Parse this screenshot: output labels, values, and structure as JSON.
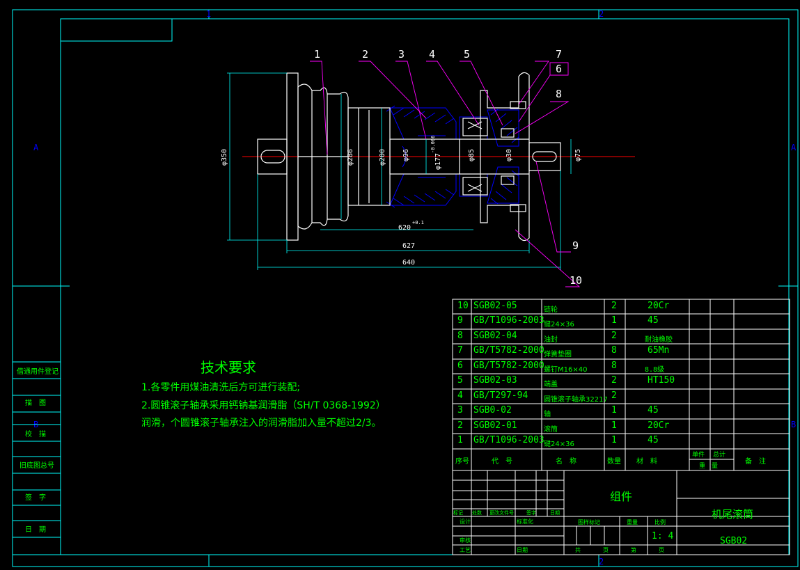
{
  "zone_marks": {
    "top_1": "1",
    "top_2": "2",
    "bottom_2": "2",
    "left_a": "A",
    "right_a": "A",
    "right_b": "B",
    "left_b": "B"
  },
  "callouts": [
    "1",
    "2",
    "3",
    "4",
    "5",
    "7",
    "6",
    "8",
    "9",
    "10"
  ],
  "dimensions": {
    "d350": "φ350",
    "d286": "φ286",
    "d200": "φ200",
    "d96": "φ96",
    "d177": "φ177",
    "tol177": "-0.066",
    "d85": "φ85",
    "d30": "φ30",
    "d75": "φ75",
    "l620": "620",
    "tol620": "+0.1",
    "l627": "627",
    "l640": "640"
  },
  "tech_requirements": {
    "title": "技术要求",
    "line1": "1.各零件用煤油清洗后方可进行装配;",
    "line2": "2.圆锥滚子轴承采用钙钠基润滑脂（SH/T 0368-1992）",
    "line3": "润滑，个圆锥滚子轴承注入的润滑脂加入量不超过2/3。"
  },
  "left_strip": [
    "借通用件登记",
    "描　图",
    "校　描",
    "旧底图总号",
    "签　字",
    "日　期"
  ],
  "bom": {
    "rows": [
      {
        "no": "10",
        "code": "SGB02-05",
        "name": "链轮",
        "qty": "2",
        "material": "20Cr"
      },
      {
        "no": "9",
        "code": "GB/T1096-2003",
        "name": "键24×36",
        "qty": "1",
        "material": "45"
      },
      {
        "no": "8",
        "code": "SGB02-04",
        "name": "油封",
        "qty": "2",
        "material": "耐油橡胶"
      },
      {
        "no": "7",
        "code": "GB/T5782-2000",
        "name": "弹簧垫圈",
        "qty": "8",
        "material": "65Mn"
      },
      {
        "no": "6",
        "code": "GB/T5782-2000",
        "name": "螺钉M16×40",
        "qty": "8",
        "material": "8.8级"
      },
      {
        "no": "5",
        "code": "SGB02-03",
        "name": "端盖",
        "qty": "2",
        "material": "HT150"
      },
      {
        "no": "4",
        "code": "GB/T297-94",
        "name": "圆锥滚子轴承32217",
        "qty": "2",
        "material": ""
      },
      {
        "no": "3",
        "code": "SGB0-02",
        "name": "轴",
        "qty": "1",
        "material": "45"
      },
      {
        "no": "2",
        "code": "SGB02-01",
        "name": "滚筒",
        "qty": "1",
        "material": "20Cr"
      },
      {
        "no": "1",
        "code": "GB/T1096-2003",
        "name": "键24×36",
        "qty": "1",
        "material": "45"
      }
    ],
    "header": {
      "no": "序号",
      "code": "代　号",
      "name": "名　称",
      "qty": "数量",
      "material": "材　料",
      "unit": "单件",
      "total": "总计",
      "weight": "重　量",
      "remark": "备　注"
    }
  },
  "title_block": {
    "assembly": "组件",
    "name": "机尾滚筒",
    "drawing_no": "SGB02",
    "scale": "1: 4",
    "rev_headers": [
      "标记",
      "处数",
      "更改文件号",
      "签字",
      "日期"
    ],
    "design": "设计",
    "std": "标准化",
    "review": "审核",
    "process": "工艺",
    "date": "日期",
    "stage_mark": "图样标记",
    "weight": "重量",
    "ratio": "比例",
    "total_sheets": "共",
    "sheet": "页",
    "page_no": "第",
    "page": "页"
  },
  "colors": {
    "frame": "#00ffff",
    "text": "#00ff00",
    "part": "#ffffff",
    "hatch": "#0000ff",
    "leader": "#ff00ff",
    "center": "#ff0000"
  }
}
